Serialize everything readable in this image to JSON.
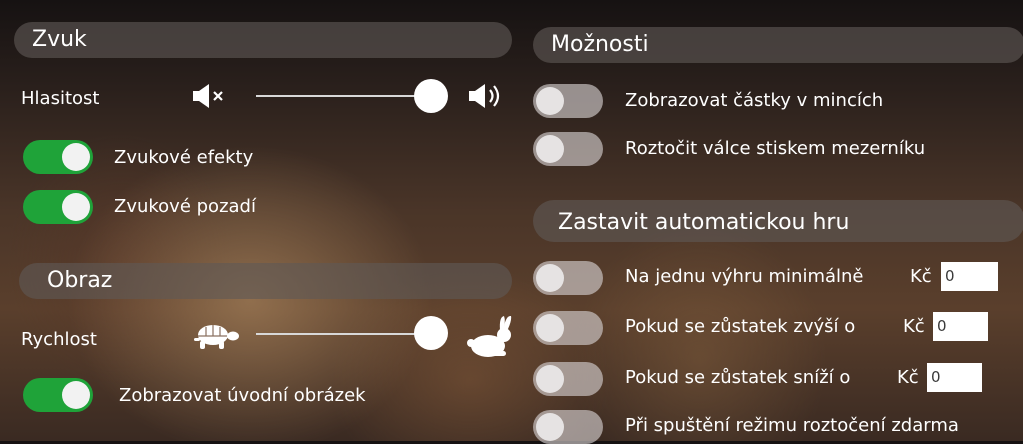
{
  "sound": {
    "header": "Zvuk",
    "volume_label": "Hlasitost",
    "volume_level_percent": 100,
    "mute_icon": "speaker-mute-icon",
    "loud_icon": "speaker-loud-icon",
    "effects_label": "Zvukové efekty",
    "effects_on": true,
    "background_label": "Zvukové pozadí",
    "background_on": true
  },
  "image": {
    "header": "Obraz",
    "speed_label": "Rychlost",
    "speed_level_percent": 100,
    "slow_icon": "turtle-icon",
    "fast_icon": "rabbit-icon",
    "intro_label": "Zobrazovat úvodní obrázek",
    "intro_on": true
  },
  "options": {
    "header": "Možnosti",
    "coins_label": "Zobrazovat částky v mincích",
    "coins_on": false,
    "spacebar_label": "Roztočit válce stiskem mezerníku",
    "spacebar_on": false
  },
  "autoplay": {
    "header": "Zastavit automatickou hru",
    "win_label": "Na jednu výhru minimálně",
    "win_currency": "Kč",
    "win_value": "0",
    "win_on": false,
    "increase_label": "Pokud se zůstatek zvýší o",
    "increase_currency": "Kč",
    "increase_value": "0",
    "increase_on": false,
    "decrease_label": "Pokud se zůstatek sníží o",
    "decrease_currency": "Kč",
    "decrease_value": "0",
    "decrease_on": false,
    "freespins_label": "Při spuštění režimu roztočení zdarma",
    "freespins_on": false
  },
  "colors": {
    "toggle_on": "#1fa339",
    "toggle_off": "#d2cdcd",
    "header_bg": "#5f5856"
  }
}
